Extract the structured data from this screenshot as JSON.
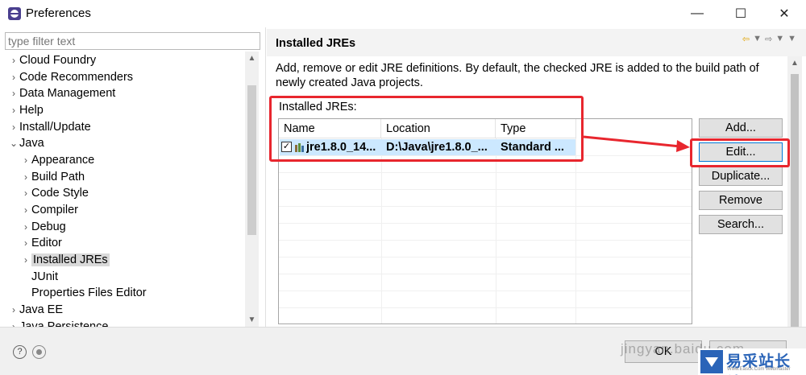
{
  "window": {
    "title": "Preferences",
    "minimize_glyph": "—",
    "maximize_glyph": "☐",
    "close_glyph": "✕"
  },
  "filter": {
    "placeholder": "type filter text"
  },
  "tree": {
    "items": [
      {
        "label": "Cloud Foundry",
        "level": 0,
        "chevron": "›"
      },
      {
        "label": "Code Recommenders",
        "level": 0,
        "chevron": "›"
      },
      {
        "label": "Data Management",
        "level": 0,
        "chevron": "›"
      },
      {
        "label": "Help",
        "level": 0,
        "chevron": "›"
      },
      {
        "label": "Install/Update",
        "level": 0,
        "chevron": "›"
      },
      {
        "label": "Java",
        "level": 0,
        "chevron": "⌄"
      },
      {
        "label": "Appearance",
        "level": 1,
        "chevron": "›"
      },
      {
        "label": "Build Path",
        "level": 1,
        "chevron": "›"
      },
      {
        "label": "Code Style",
        "level": 1,
        "chevron": "›"
      },
      {
        "label": "Compiler",
        "level": 1,
        "chevron": "›"
      },
      {
        "label": "Debug",
        "level": 1,
        "chevron": "›"
      },
      {
        "label": "Editor",
        "level": 1,
        "chevron": "›"
      },
      {
        "label": "Installed JREs",
        "level": 1,
        "chevron": "›",
        "selected": true
      },
      {
        "label": "JUnit",
        "level": 1,
        "chevron": ""
      },
      {
        "label": "Properties Files Editor",
        "level": 1,
        "chevron": ""
      },
      {
        "label": "Java EE",
        "level": 0,
        "chevron": "›"
      },
      {
        "label": "Java Persistence",
        "level": 0,
        "chevron": "›"
      }
    ]
  },
  "page": {
    "title": "Installed JREs",
    "description": "Add, remove or edit JRE definitions. By default, the checked JRE is added to the build path of newly created Java projects.",
    "section_label": "Installed JREs:"
  },
  "table": {
    "columns": [
      "Name",
      "Location",
      "Type"
    ],
    "rows": [
      {
        "checked": true,
        "check_glyph": "✓",
        "name": "jre1.8.0_14...",
        "location": "D:\\Java\\jre1.8.0_...",
        "type": "Standard ..."
      }
    ]
  },
  "buttons": {
    "add": "Add...",
    "edit": "Edit...",
    "duplicate": "Duplicate...",
    "remove": "Remove",
    "search": "Search..."
  },
  "footer": {
    "help_glyph": "?",
    "ok_label": "OK"
  },
  "watermark": {
    "text": "jingyan.baidu.com",
    "logo_text": "易采站长站",
    "logo_sub": "Www.Easck.Com Webmaster"
  },
  "colors": {
    "annotation": "#e8262e",
    "selection": "#cce8ff",
    "focus_border": "#0078d7",
    "logo_blue": "#2a64b8"
  }
}
